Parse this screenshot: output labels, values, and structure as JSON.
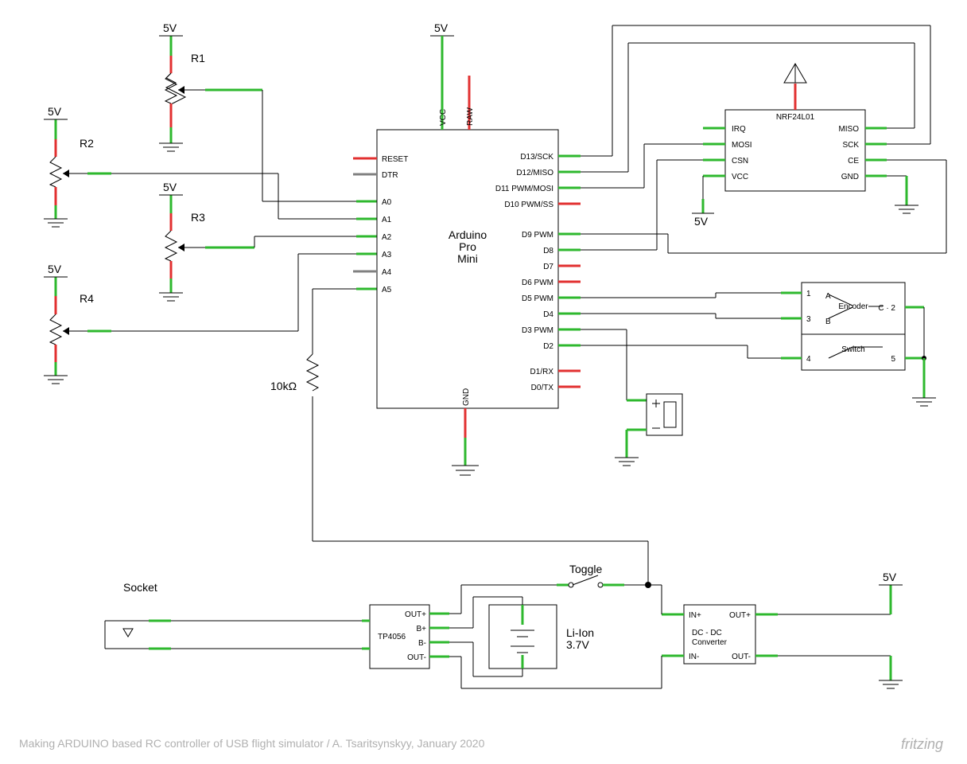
{
  "rails": {
    "v5": "5V"
  },
  "pots": {
    "r1": "R1",
    "r2": "R2",
    "r3": "R3",
    "r4": "R4"
  },
  "pull": {
    "label": "10kΩ"
  },
  "arduino": {
    "name": "Arduino\nPro\nMini",
    "left": [
      "RESET",
      "DTR",
      "A0",
      "A1",
      "A2",
      "A3",
      "A4",
      "A5"
    ],
    "right": [
      "D13/SCK",
      "D12/MISO",
      "D11 PWM/MOSI",
      "D10 PWM/SS",
      "",
      "D9 PWM",
      "D8",
      "D7",
      "D6 PWM",
      "D5 PWM",
      "D4",
      "D3 PWM",
      "D2",
      "",
      "D1/RX",
      "D0/TX"
    ],
    "top": {
      "vcc": "VCC",
      "raw": "RAW"
    },
    "bot": {
      "gnd": "GND"
    }
  },
  "nrf": {
    "name": "NRF24L01",
    "left": [
      "IRQ",
      "MOSI",
      "CSN",
      "VCC"
    ],
    "right": [
      "MISO",
      "SCK",
      "CE",
      "GND"
    ]
  },
  "encoder": {
    "name": "Encoder",
    "sw": "Switch",
    "pins": {
      "p1": "1",
      "p2": "3",
      "p3": "4",
      "pa": "A",
      "pb": "B",
      "pc": "C · 2",
      "psw": "5"
    }
  },
  "toggle": {
    "label": "Toggle"
  },
  "power": {
    "socket": "Socket",
    "tp": {
      "name": "TP4056",
      "out_p": "OUT+",
      "b_p": "B+",
      "b_n": "B-",
      "out_n": "OUT-"
    },
    "batt": {
      "name": "Li-Ion",
      "volt": "3.7V"
    },
    "dc": {
      "name": "DC - DC\nConverter",
      "in_p": "IN+",
      "in_n": "IN-",
      "out_p": "OUT+",
      "out_n": "OUT-"
    }
  },
  "footer": "Making ARDUINO based RC controller of USB flight simulator / A. Tsaritsynskyy, January 2020",
  "brand": "fritzing"
}
